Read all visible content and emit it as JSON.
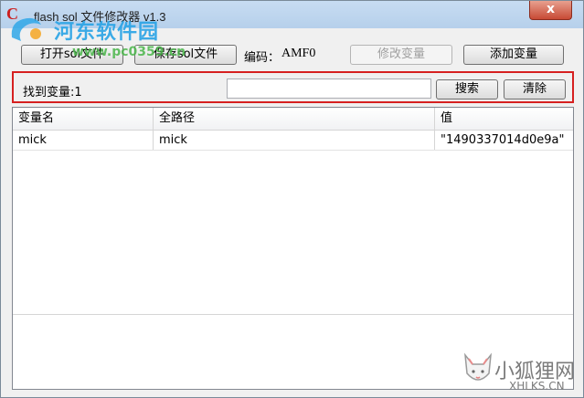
{
  "window": {
    "title": "flash sol 文件修改器 v1.3",
    "close_symbol": "x",
    "app_icon_letter": "C"
  },
  "toolbar": {
    "open_label": "打开sol文件",
    "save_label": "保存sol文件",
    "encoding_label": "编码：",
    "encoding_value": "AMF0",
    "modify_label": "修改变量",
    "add_label": "添加变量"
  },
  "search": {
    "found_label": "找到变量:1",
    "input_value": "",
    "search_label": "搜索",
    "clear_label": "清除"
  },
  "table": {
    "columns": [
      "变量名",
      "全路径",
      "值"
    ],
    "rows": [
      [
        "mick",
        "mick",
        "\"1490337014d0e9a\""
      ]
    ]
  },
  "watermarks": {
    "top_site": "河东软件园",
    "top_url": "www.pc0359.cn",
    "bottom_site": "小狐狸网",
    "bottom_url": "XHLKS.CN"
  },
  "colors": {
    "highlight_border": "#d62020",
    "titlebar": "#c7dcf2",
    "close_button": "#c74a35"
  }
}
